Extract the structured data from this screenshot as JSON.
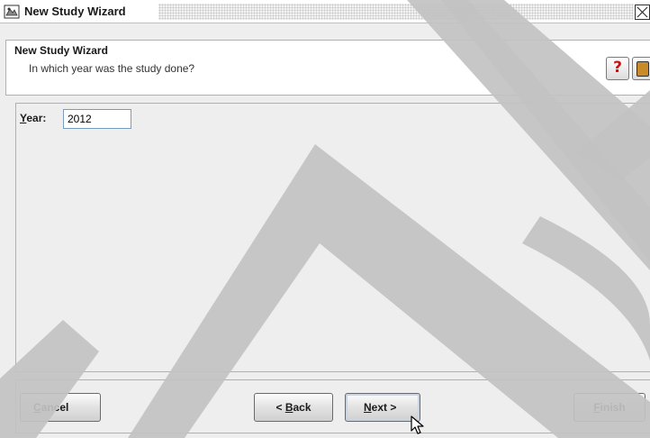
{
  "window": {
    "title": "New Study Wizard",
    "icon": "wizard-app-icon",
    "close_icon": "close-icon"
  },
  "header": {
    "title": "New Study Wizard",
    "subtitle": "In which year was the study done?",
    "help_label": "?",
    "help_icon": "help-question-icon",
    "book_icon": "book-icon"
  },
  "form": {
    "year_label": "Year:",
    "year_value": "2012"
  },
  "buttons": {
    "cancel": "Cancel",
    "back": "< Back",
    "next": "Next >",
    "finish": "Finish"
  },
  "colors": {
    "background": "#eeeeee",
    "panel": "#ffffff",
    "help_red": "#cc1010",
    "book_brown": "#c98a2a",
    "watermark": "#bfbfbf"
  }
}
